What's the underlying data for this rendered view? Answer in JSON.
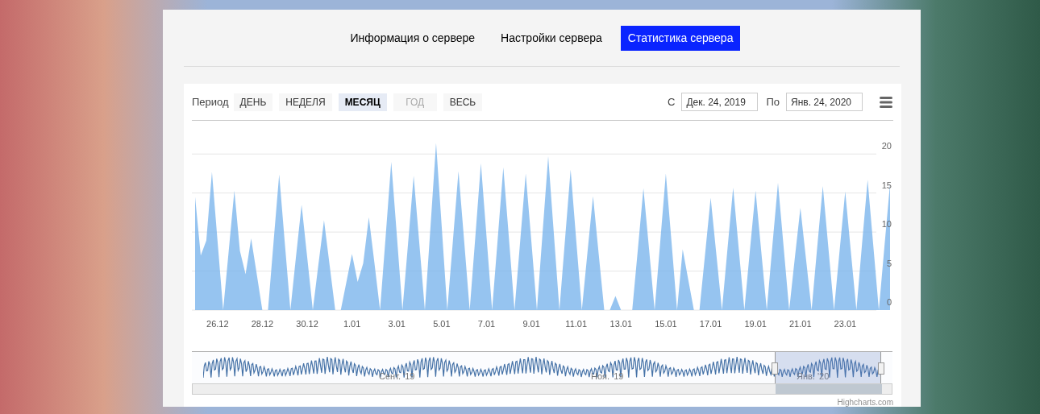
{
  "tabs": [
    {
      "label": "Информация о сервере",
      "selected": false
    },
    {
      "label": "Настройки сервера",
      "selected": false
    },
    {
      "label": "Статистика сервера",
      "selected": true
    }
  ],
  "chart": {
    "range_selector": {
      "label": "Период",
      "buttons": [
        {
          "label": "ДЕНЬ",
          "selected": false,
          "disabled": false
        },
        {
          "label": "НЕДЕЛЯ",
          "selected": false,
          "disabled": false
        },
        {
          "label": "МЕСЯЦ",
          "selected": true,
          "disabled": false
        },
        {
          "label": "ГОД",
          "selected": false,
          "disabled": true
        },
        {
          "label": "ВЕСЬ",
          "selected": false,
          "disabled": false
        }
      ]
    },
    "date_from": {
      "label": "С",
      "value": "Дек. 24, 2019"
    },
    "date_to": {
      "label": "По",
      "value": "Янв. 24, 2020"
    },
    "chart_data": {
      "type": "area",
      "ylim": [
        0,
        29
      ],
      "yticks": [
        0,
        5,
        10,
        15,
        20
      ],
      "grid": true,
      "categories": [
        null,
        null,
        null,
        null,
        "26.12",
        null,
        null,
        null,
        null,
        null,
        null,
        null,
        "28.12",
        null,
        null,
        null,
        null,
        null,
        null,
        null,
        "30.12",
        null,
        null,
        null,
        null,
        null,
        null,
        null,
        "1.01",
        null,
        null,
        null,
        null,
        null,
        null,
        null,
        "3.01",
        null,
        null,
        null,
        null,
        null,
        null,
        null,
        "5.01",
        null,
        null,
        null,
        null,
        null,
        null,
        null,
        "7.01",
        null,
        null,
        null,
        null,
        null,
        null,
        null,
        "9.01",
        null,
        null,
        null,
        null,
        null,
        null,
        null,
        "11.01",
        null,
        null,
        null,
        null,
        null,
        null,
        null,
        "13.01",
        null,
        null,
        null,
        null,
        null,
        null,
        null,
        "15.01",
        null,
        null,
        null,
        null,
        null,
        null,
        null,
        "17.01",
        null,
        null,
        null,
        null,
        null,
        null,
        null,
        "19.01",
        null,
        null,
        null,
        null,
        null,
        null,
        null,
        "21.01",
        null,
        null,
        null,
        null,
        null,
        null,
        null,
        "23.01",
        null,
        null,
        null,
        null,
        null,
        null,
        null,
        null
      ],
      "series": [
        {
          "color": "#7cb5ec",
          "values": [
            14.5,
            7,
            8.9,
            17.7,
            8.9,
            0,
            7.6,
            15.3,
            7.6,
            4.6,
            9.2,
            4.6,
            0,
            0,
            8.7,
            17.4,
            8.7,
            0,
            6.8,
            13.5,
            6.8,
            0,
            5.8,
            11.5,
            5.8,
            0,
            0,
            3.6,
            7.2,
            3.6,
            6,
            11.9,
            6,
            0,
            9.5,
            19,
            9.5,
            0,
            8.6,
            17.2,
            8.6,
            0,
            10.7,
            21.4,
            10.7,
            0,
            8.9,
            17.8,
            8.9,
            0,
            9.4,
            18.8,
            9.4,
            0,
            9.2,
            18.3,
            9.2,
            0,
            8.8,
            17.5,
            8.8,
            0,
            9.9,
            19.7,
            9.9,
            0,
            9,
            18,
            9,
            0,
            7.3,
            14.6,
            7.3,
            0,
            0,
            1.8,
            0,
            0,
            0,
            7.8,
            15.6,
            7.8,
            0,
            8.8,
            17.5,
            8.8,
            0,
            7.8,
            3.9,
            0,
            0,
            7.2,
            14.4,
            7.2,
            0,
            7.9,
            15.7,
            7.9,
            0,
            7.7,
            15.3,
            7.7,
            0,
            8.2,
            16.3,
            8.2,
            0,
            6.6,
            13.1,
            6.6,
            0,
            8,
            15.9,
            8,
            0,
            7.6,
            15.2,
            7.6,
            0,
            8.4,
            16.7,
            8.4,
            0,
            8.1,
            16.2
          ]
        }
      ]
    },
    "navigator": {
      "labels": [
        "Сент. '19",
        "Ноя. '19",
        "Янв. '20"
      ]
    },
    "credits": "Highcharts.com"
  }
}
